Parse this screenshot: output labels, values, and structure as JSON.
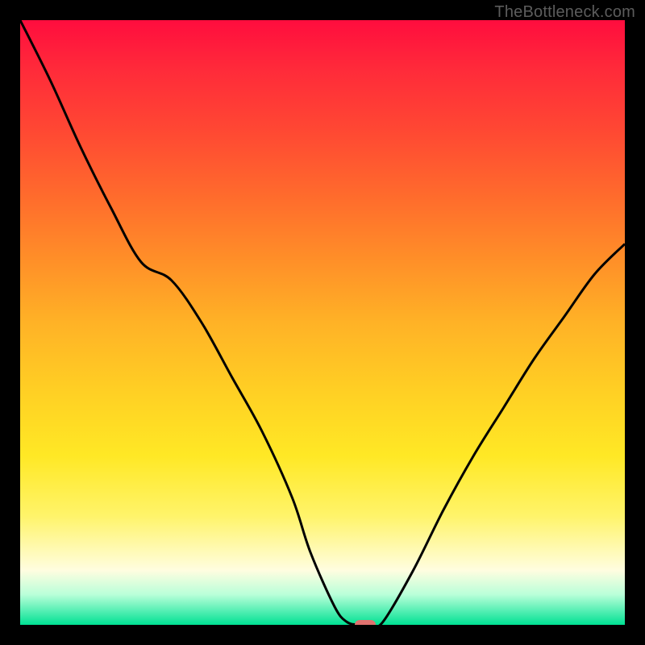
{
  "watermark": {
    "text": "TheBottleneck.com"
  },
  "chart_data": {
    "type": "line",
    "title": "",
    "xlabel": "",
    "ylabel": "",
    "xlim": [
      0,
      100
    ],
    "ylim": [
      0,
      100
    ],
    "x": [
      0,
      5,
      10,
      15,
      20,
      25,
      30,
      35,
      40,
      45,
      48,
      52,
      54,
      56,
      58,
      60,
      65,
      70,
      75,
      80,
      85,
      90,
      95,
      100
    ],
    "y": [
      100,
      90,
      79,
      69,
      60,
      57,
      50,
      41,
      32,
      21,
      12,
      3,
      0.5,
      0,
      0,
      0.5,
      9,
      19,
      28,
      36,
      44,
      51,
      58,
      63
    ],
    "marker": {
      "x": 57,
      "y": 0
    },
    "colors": {
      "gradient": [
        "#ff0d3e",
        "#ff4733",
        "#ff9028",
        "#ffd124",
        "#fff46a",
        "#fffde0",
        "#00e193"
      ],
      "curve": "#000000",
      "marker": "#e0726f",
      "frame": "#000000"
    }
  }
}
